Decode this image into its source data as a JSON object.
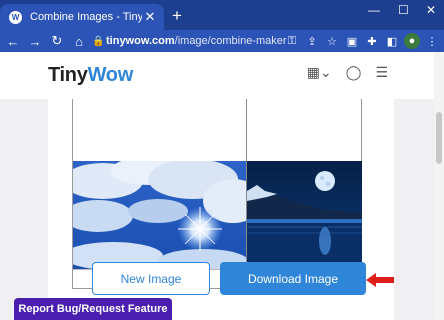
{
  "browser": {
    "tab_title": "Combine Images - TinyWow",
    "tab_close": "✕",
    "new_tab": "+",
    "url_domain": "tinywow.com",
    "url_path": "/image/combine-maker"
  },
  "site": {
    "logo_tiny": "Tiny",
    "logo_wow": "Wow"
  },
  "actions": {
    "new_image": "New Image",
    "download_image": "Download Image"
  },
  "report": {
    "label": "Report Bug/Request Feature"
  },
  "colors": {
    "browser_dark": "#1e3f8f",
    "browser_blue": "#2b54b6",
    "accent": "#2f86d8",
    "report_purple": "#4a1fb0",
    "arrow_red": "#e01e1e"
  },
  "icons": [
    "back-icon",
    "forward-icon",
    "reload-icon",
    "home-icon",
    "lock-icon",
    "key-icon",
    "share-icon",
    "star-icon",
    "extension-icon",
    "puzzle-icon",
    "sidebar-icon",
    "profile-avatar",
    "menu-kebab-icon",
    "grid-icon",
    "search-icon",
    "hamburger-icon"
  ]
}
